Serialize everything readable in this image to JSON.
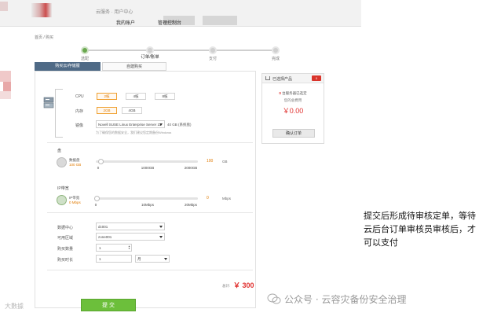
{
  "header": {
    "brand": "云服务 · 用户中心",
    "nav_items": [
      "我的账户",
      "管理控制台"
    ]
  },
  "breadcrumb": "首页 / 购买",
  "steps": [
    {
      "label": "选配"
    },
    {
      "label": "订单/账单",
      "caption": "订单/账单"
    },
    {
      "label": "支付"
    },
    {
      "label": "完成"
    }
  ],
  "tabs": [
    "购买云/存储服",
    "自建购买"
  ],
  "config": {
    "cpu_label": "CPU",
    "cpu_options": [
      "2核",
      "4核",
      "8核"
    ],
    "mem_label": "内存",
    "mem_options": [
      "2GB",
      "4GB"
    ],
    "image_label": "镜像",
    "image_value": "Novell SUSE Linux Enterprise Server 11",
    "disk_hint": "40 GB (系统盘)",
    "image_note": "为了确保您的数据安全，我们建议您定期备份Windows"
  },
  "storage": {
    "section_label": "盘",
    "icon_label": "数据盘",
    "icon_sub": "100 GB",
    "ticks": [
      "0",
      "1000GB",
      "2000GB"
    ],
    "value": "100",
    "unit": "GB"
  },
  "bandwidth": {
    "section_label": "IP带宽",
    "icon_label": "IP带宽",
    "icon_sub": "0 Mbps",
    "ticks": [
      "0",
      "10Mbps",
      "20Mbps"
    ],
    "value": "0",
    "unit": "Mbps"
  },
  "order": {
    "dc_label": "数据中心",
    "dc_value": "dc001",
    "zone_label": "可用区域",
    "zone_value": "zone001",
    "qty_label": "购买数量",
    "qty_value": "1",
    "dur_label": "购买时长",
    "dur_value": "1",
    "dur_unit": "月"
  },
  "price_label": "总计:",
  "price_value": "￥ 300",
  "submit_label": "提 交",
  "cart": {
    "title": "已选择产品",
    "badge": "0",
    "count_prefix": "0",
    "count_text": "台服务器已选定",
    "fee_text": "您的总费用",
    "total": "￥0.00",
    "confirm_label": "确认订单"
  },
  "annotation": "提交后形成待审核定单，等待云后台订单审核员审核后，才可以支付",
  "wechat_text": "公众号 · 云容灾备份安全治理",
  "watermark": "大數據"
}
